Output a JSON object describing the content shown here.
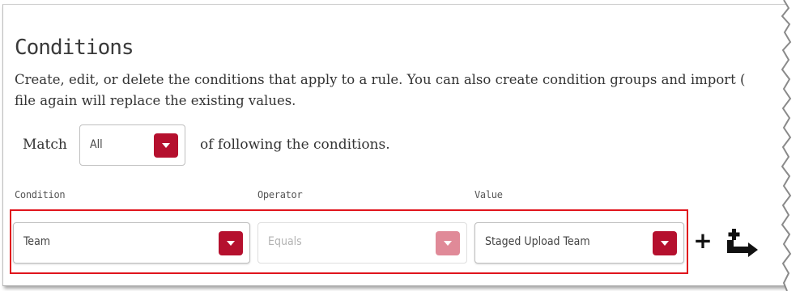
{
  "section": {
    "title": "Conditions",
    "description_line1": "Create, edit, or delete the conditions that apply to a rule. You can also create condition groups and import (",
    "description_line2": "file again will replace the existing values."
  },
  "match": {
    "label": "Match",
    "selected": "All",
    "suffix": "of following the conditions."
  },
  "columns": {
    "condition": "Condition",
    "operator": "Operator",
    "value": "Value"
  },
  "condition_row": {
    "condition": "Team",
    "operator": "Equals",
    "value": "Staged Upload Team",
    "operator_disabled": true
  },
  "actions": {
    "add_symbol": "+",
    "add_icon": "plus-icon",
    "group_icon": "add-condition-group-icon"
  },
  "colors": {
    "accent": "#b5102e",
    "accent_disabled": "#e08a98",
    "highlight_border": "#e0141c"
  }
}
